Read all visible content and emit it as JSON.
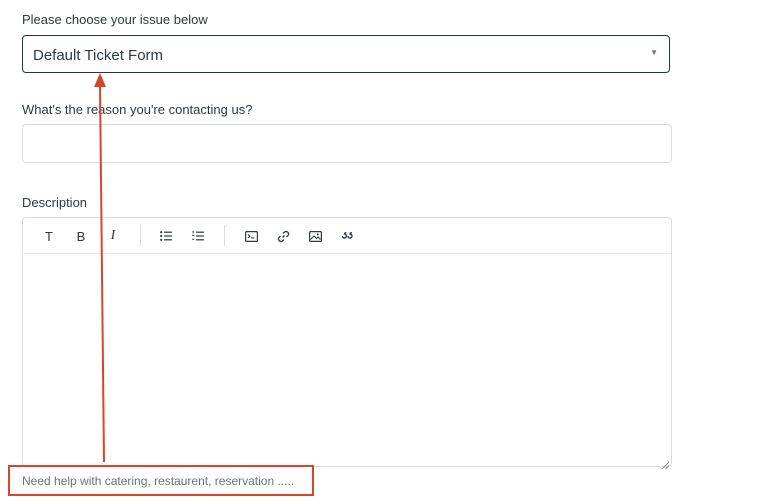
{
  "form": {
    "issue_label": "Please choose your issue below",
    "issue_selected": "Default Ticket Form",
    "reason_label": "What's the reason you're contacting us?",
    "reason_value": "",
    "description_label": "Description",
    "description_hint": "Need help with catering, restaurent, reservation ....."
  },
  "toolbar": {
    "text_style_glyph": "T",
    "bold_glyph": "B",
    "italic_glyph": "I",
    "icons": [
      "text-style-icon",
      "bold-icon",
      "italic-icon",
      "bulleted-list-icon",
      "numbered-list-icon",
      "code-block-icon",
      "link-icon",
      "image-icon",
      "blockquote-icon"
    ]
  },
  "annotation": {
    "color": "#d9442a"
  }
}
